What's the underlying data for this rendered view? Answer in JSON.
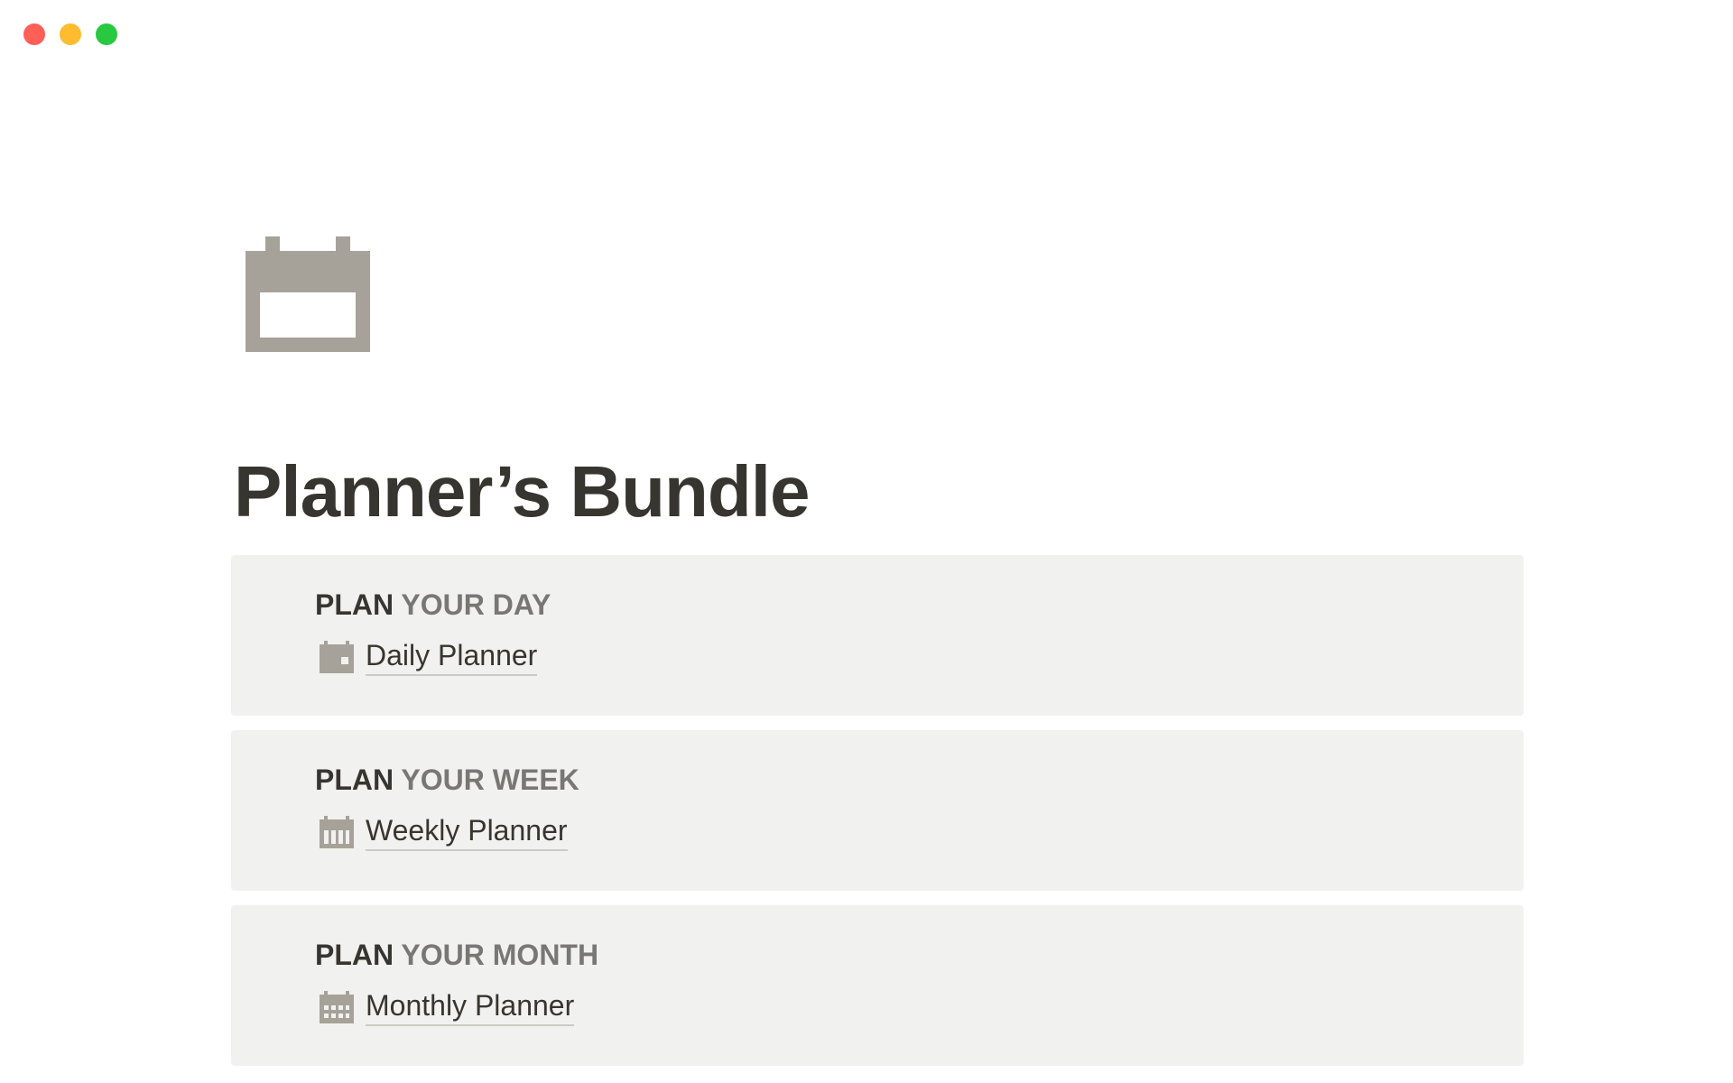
{
  "window": {
    "traffic_lights": [
      {
        "name": "close",
        "color": "#ff5f57"
      },
      {
        "name": "minimize",
        "color": "#febc2e"
      },
      {
        "name": "zoom",
        "color": "#28c840"
      }
    ]
  },
  "page": {
    "icon": "calendar-icon",
    "icon_color": "#a6a299",
    "title": "Planner’s Bundle"
  },
  "sections": [
    {
      "heading_primary": "PLAN",
      "heading_secondary": "YOUR DAY",
      "link_label": "Daily Planner",
      "link_icon": "daily-calendar-icon"
    },
    {
      "heading_primary": "PLAN",
      "heading_secondary": "YOUR WEEK",
      "link_label": "Weekly Planner",
      "link_icon": "weekly-calendar-icon"
    },
    {
      "heading_primary": "PLAN",
      "heading_secondary": "YOUR MONTH",
      "link_label": "Monthly Planner",
      "link_icon": "monthly-calendar-icon"
    }
  ],
  "colors": {
    "text": "#37352f",
    "text_secondary": "#787774",
    "callout_bg": "#f1f1ef",
    "icon_gray": "#a6a299"
  }
}
